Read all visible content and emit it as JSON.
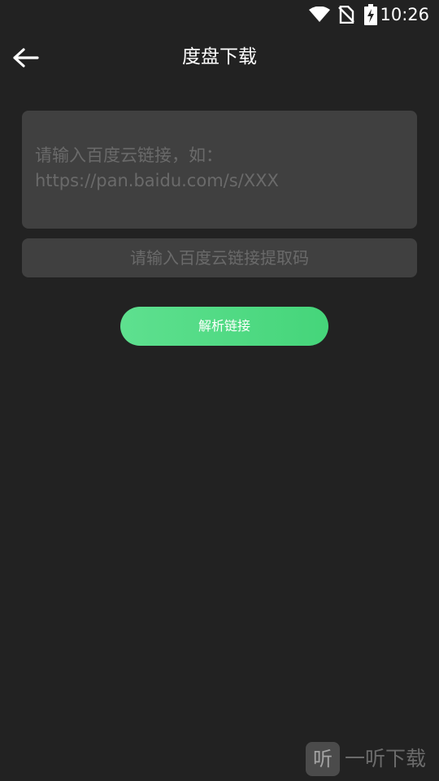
{
  "status_bar": {
    "time": "10:26",
    "icons": [
      "wifi-icon",
      "no-signal-icon",
      "battery-charging-icon"
    ]
  },
  "app_bar": {
    "back_icon": "arrow-left-icon",
    "title": "度盘下载"
  },
  "form": {
    "link_placeholder": "请输入百度云链接，如：\nhttps://pan.baidu.com/s/XXX",
    "link_value": "",
    "code_placeholder": "请输入百度云链接提取码",
    "code_value": "",
    "parse_button_label": "解析链接"
  },
  "watermark": {
    "logo_glyph": "听",
    "text": "一听下载"
  },
  "colors": {
    "background": "#222222",
    "input_background": "#404040",
    "placeholder": "#6a6a6a",
    "accent": "#4ddb82",
    "text": "#ffffff"
  }
}
